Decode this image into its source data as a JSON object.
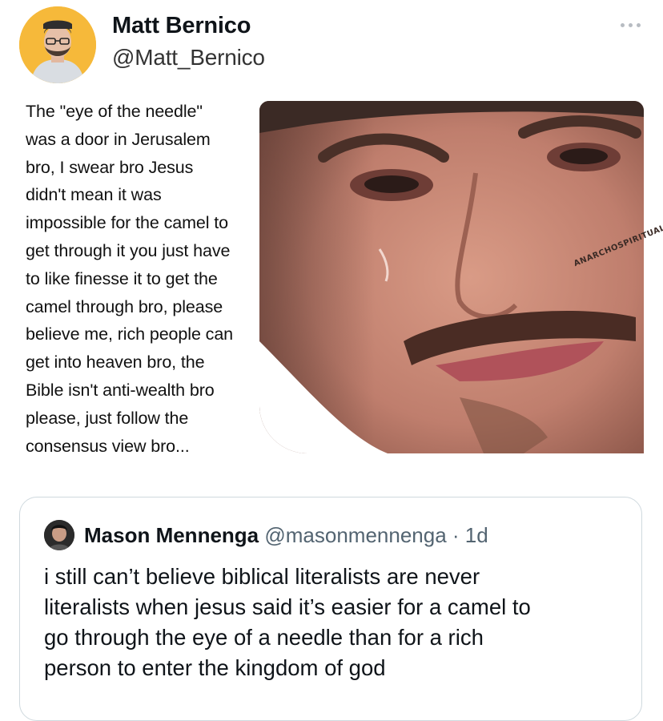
{
  "tweet": {
    "author_name": "Matt Bernico",
    "author_handle": "@Matt_Bernico",
    "more_icon": "more-horizontal-icon",
    "avatar_bg": "#f6b93a"
  },
  "meme": {
    "caption": "The \"eye of the needle\"\nwas a door in Jerusalem\nbro, I swear bro Jesus\ndidn't mean it was\nimpossible for the camel to\nget through it you just have\nto like finesse it to get the\ncamel through bro, please\nbelieve me, rich people can\nget into heaven bro, the\nBible isn't anti-wealth bro\nplease, just follow the\nconsensus view bro...",
    "watermark": "ANARCHOSPIRITUALITY"
  },
  "quoted_tweet": {
    "author_name": "Mason Mennenga",
    "author_handle": "@masonmennenga",
    "separator": " · ",
    "time": "1d",
    "text": "i still can’t believe biblical literalists are never\nliteralists when jesus said it’s easier for a camel to\ngo through the eye of a needle than for a rich\nperson to enter the kingdom of god"
  }
}
